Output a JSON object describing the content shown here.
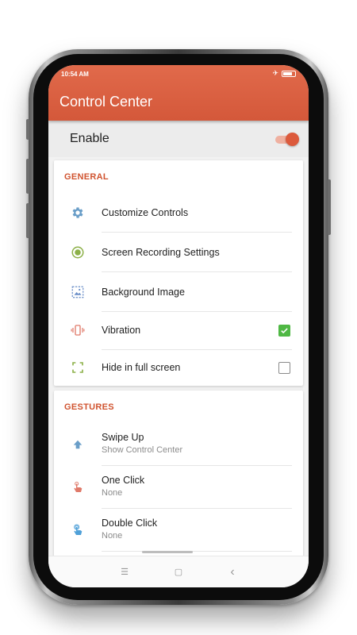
{
  "status_bar": {
    "time": "10:54 AM"
  },
  "app_bar": {
    "title": "Control Center"
  },
  "enable": {
    "label": "Enable",
    "on": true
  },
  "general": {
    "header": "GENERAL",
    "items": [
      {
        "label": "Customize Controls",
        "icon": "gear-icon",
        "icon_color": "#6a9ec8"
      },
      {
        "label": "Screen Recording Settings",
        "icon": "record-icon",
        "icon_color": "#8cb048"
      },
      {
        "label": "Background Image",
        "icon": "image-icon",
        "icon_color": "#6a8ec8"
      },
      {
        "label": "Vibration",
        "icon": "vibration-icon",
        "icon_color": "#e07a6a",
        "checked": true
      },
      {
        "label": "Hide in full screen",
        "icon": "fullscreen-icon",
        "icon_color": "#8cb048",
        "checked": false
      }
    ]
  },
  "gestures": {
    "header": "GESTURES",
    "items": [
      {
        "label": "Swipe Up",
        "value": "Show Control Center",
        "icon": "arrow-up-icon",
        "icon_color": "#6a9ec8"
      },
      {
        "label": "One Click",
        "value": "None",
        "icon": "tap-icon",
        "icon_color": "#e07a6a"
      },
      {
        "label": "Double Click",
        "value": "None",
        "icon": "double-tap-icon",
        "icon_color": "#4fa0d8"
      }
    ]
  },
  "navbar": {
    "menu_glyph": "☰",
    "home_glyph": "▢",
    "back_glyph": "‹"
  },
  "colors": {
    "accent": "#d4583a",
    "check_green": "#4fb844"
  }
}
